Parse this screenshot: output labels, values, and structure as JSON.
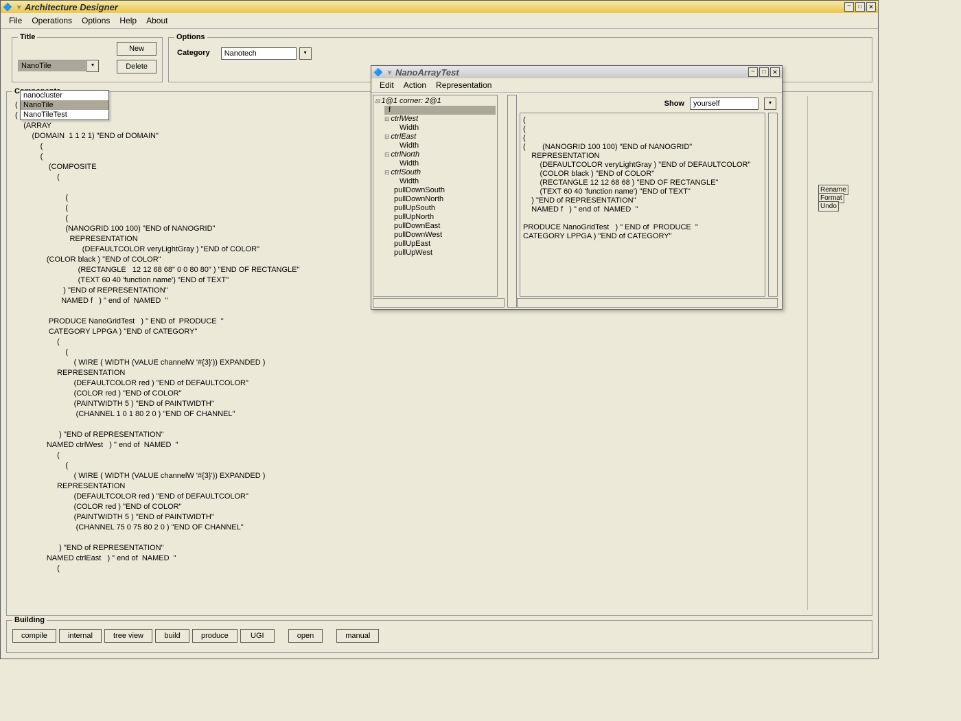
{
  "main": {
    "title": "Architecture Designer",
    "menu": {
      "file": "File",
      "operations": "Operations",
      "options": "Options",
      "help": "Help",
      "about": "About"
    },
    "titleBox": {
      "legend": "Title",
      "new": "New",
      "delete": "Delete",
      "selected": "NanoTile",
      "dropdown": [
        "nanocluster",
        "NanoTile",
        "NanoTileTest"
      ]
    },
    "optionsBox": {
      "legend": "Options",
      "categoryLabel": "Category",
      "categoryValue": "Nanotech"
    },
    "components": {
      "legend": "Components",
      "code": "(\n(\n    (ARRAY\n        (DOMAIN  1 1 2 1) \"END of DOMAIN\"\n            (\n            (\n                (COMPOSITE\n                    (\n\n                        (\n                        (\n                        (\n                        (NANOGRID 100 100) \"END of NANOGRID\"\n                          REPRESENTATION\n                                (DEFAULTCOLOR veryLightGray ) \"END of COLOR\"\n               (COLOR black ) \"END of COLOR\"\n                              (RECTANGLE   12 12 68 68\" 0 0 80 80\" ) \"END OF RECTANGLE\"\n                              (TEXT 60 40 'function name') \"END of TEXT\"\n                       ) \"END of REPRESENTATION\"\n                      NAMED f   ) \" end of  NAMED  \"\n\n                PRODUCE NanoGridTest   ) \" END of  PRODUCE  \"\n                CATEGORY LPPGA ) \"END of CATEGORY\"\n                    (\n                        (\n                            ( WIRE ( WIDTH (VALUE channelW '#{3}')) EXPANDED )\n                    REPRESENTATION\n                            (DEFAULTCOLOR red ) \"END of DEFAULTCOLOR\"\n                            (COLOR red ) \"END of COLOR\"\n                            (PAINTWIDTH 5 ) \"END of PAINTWIDTH\"\n                             (CHANNEL 1 0 1 80 2 0 ) \"END OF CHANNEL\"\n\n                     ) \"END of REPRESENTATION\"\n               NAMED ctrlWest   ) \" end of  NAMED  \"\n                    (\n                        (\n                            ( WIRE ( WIDTH (VALUE channelW '#{3}')) EXPANDED )\n                    REPRESENTATION\n                            (DEFAULTCOLOR red ) \"END of DEFAULTCOLOR\"\n                            (COLOR red ) \"END of COLOR\"\n                            (PAINTWIDTH 5 ) \"END of PAINTWIDTH\"\n                             (CHANNEL 75 0 75 80 2 0 ) \"END OF CHANNEL\"\n\n                     ) \"END of REPRESENTATION\"\n               NAMED ctrlEast   ) \" end of  NAMED  \"\n                    ("
    },
    "sideButtons": {
      "rename": "Rename",
      "format": "Format",
      "undo": "Undo"
    },
    "building": {
      "legend": "Building",
      "buttons": [
        "compile",
        "internal",
        "tree view",
        "build",
        "produce",
        "UGI",
        "open",
        "manual"
      ]
    }
  },
  "sub": {
    "title": "NanoArrayTest",
    "menu": {
      "edit": "Edit",
      "action": "Action",
      "representation": "Representation"
    },
    "tree": {
      "root": "1@1 corner: 2@1",
      "selected": "f",
      "nodes": [
        {
          "n": "ctrlWest",
          "c": [
            "Width"
          ]
        },
        {
          "n": "ctrlEast",
          "c": [
            "Width"
          ]
        },
        {
          "n": "ctrlNorth",
          "c": [
            "Width"
          ]
        },
        {
          "n": "ctrlSouth",
          "c": [
            "Width"
          ]
        },
        {
          "n": "pullDownSouth"
        },
        {
          "n": "pullDownNorth"
        },
        {
          "n": "pullUpSouth"
        },
        {
          "n": "pullUpNorth"
        },
        {
          "n": "pullDownEast"
        },
        {
          "n": "pullDownWest"
        },
        {
          "n": "pullUpEast"
        },
        {
          "n": "pullUpWest"
        }
      ]
    },
    "showLabel": "Show",
    "showValue": "yourself",
    "detail": "(\n(\n(\n(        (NANOGRID 100 100) \"END of NANOGRID\"\n    REPRESENTATION\n        (DEFAULTCOLOR veryLightGray ) \"END of DEFAULTCOLOR\"\n        (COLOR black ) \"END of COLOR\"\n        (RECTANGLE 12 12 68 68 ) \"END OF RECTANGLE\"\n        (TEXT 60 40 'function name') \"END of TEXT\"\n    ) \"END of REPRESENTATION\"\n    NAMED f   ) \" end of  NAMED  \"\n\nPRODUCE NanoGridTest   ) \" END of  PRODUCE  \"\nCATEGORY LPPGA ) \"END of CATEGORY\""
  }
}
